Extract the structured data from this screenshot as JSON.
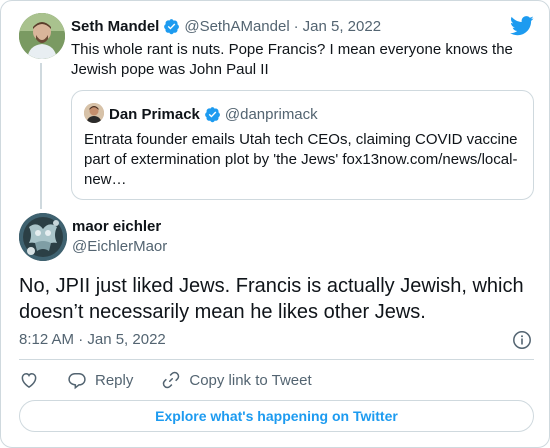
{
  "parent_tweet": {
    "author_name": "Seth Mandel",
    "author_handle": "@SethAMandel",
    "separator": "·",
    "date": "Jan 5, 2022",
    "text": "This whole rant is nuts. Pope Francis? I mean everyone knows the Jewish pope was John Paul II",
    "verified": true
  },
  "quoted_tweet": {
    "author_name": "Dan Primack",
    "author_handle": "@danprimack",
    "text": "Entrata founder emails Utah tech CEOs, claiming COVID vaccine part of extermination plot by 'the Jews' fox13now.com/news/local-new…",
    "verified": true
  },
  "main_tweet": {
    "author_name": "maor eichler",
    "author_handle": "@EichlerMaor",
    "text": "No, JPII just liked Jews. Francis is actually Jewish, which doesn’t necessarily mean he likes other Jews.",
    "timestamp": "8:12 AM · Jan 5, 2022"
  },
  "actions": {
    "like_icon": "heart-icon",
    "reply_label": "Reply",
    "copy_link_label": "Copy link to Tweet"
  },
  "explore_button_label": "Explore what's happening on Twitter",
  "colors": {
    "accent": "#1d9bf0",
    "text_primary": "#0f1419",
    "text_secondary": "#536471",
    "border": "#cfd9de"
  }
}
